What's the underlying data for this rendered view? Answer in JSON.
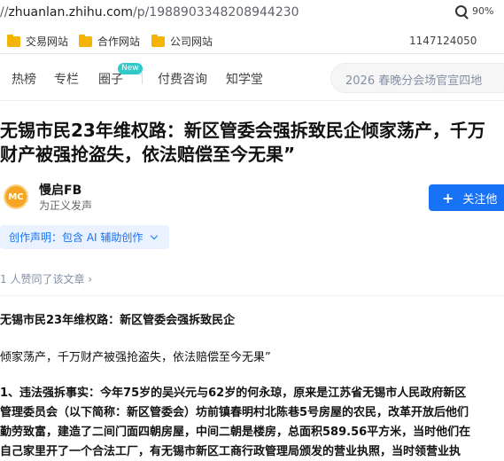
{
  "browser": {
    "url_scheme": "//",
    "url_host": "zhuanlan.zhihu.com",
    "url_path": "/p/1988903348208944230",
    "zoom": "90%"
  },
  "bookmarks": {
    "items": [
      {
        "label": "交易网站"
      },
      {
        "label": "合作网站"
      },
      {
        "label": "公司网站"
      }
    ],
    "number": "1147124050"
  },
  "nav": {
    "items": [
      "热榜",
      "专栏",
      "圈子",
      "付费咨询",
      "知学堂"
    ],
    "badge": "New",
    "search_placeholder": "2026 春晚分会场官宣四地"
  },
  "article": {
    "title_line1": "无锡市民23年维权路：新区管委会强拆致民企倾家荡产，千万",
    "title_line2": "财产被强抢盗失，依法赔偿至今无果”",
    "author": {
      "avatar_text": "MC",
      "name": "慢启FB",
      "bio": "为正义发声"
    },
    "follow_label": "关注他",
    "follow_plus": "+",
    "statement": "创作声明：包含 AI 辅助创作",
    "agree": "1 人赞同了该文章",
    "agree_arrow": "›",
    "subtitle_line1": "无锡市民23年维权路：新区管委会强拆致民企",
    "subtitle_line2": "倾家荡产，千万财产被强抢盗失，依法赔偿至今无果”",
    "body_lines": [
      "1、违法强拆事实：今年75岁的吴兴元与62岁的何永琼，原来是江苏省无锡市人民政府新区",
      "管理委员会（以下简称：新区管委会）坊前镇春明村北陈巷5号房屋的农民，改革开放后他们",
      "勤劳致富，建造了二间门面四朝房屋，中间二朝是楼房，总面积589.56平方米，当时他们在",
      "自己家里开了一个合法工厂，有无锡市新区工商行政管理局颁发的营业执照，当时领营业执"
    ]
  }
}
